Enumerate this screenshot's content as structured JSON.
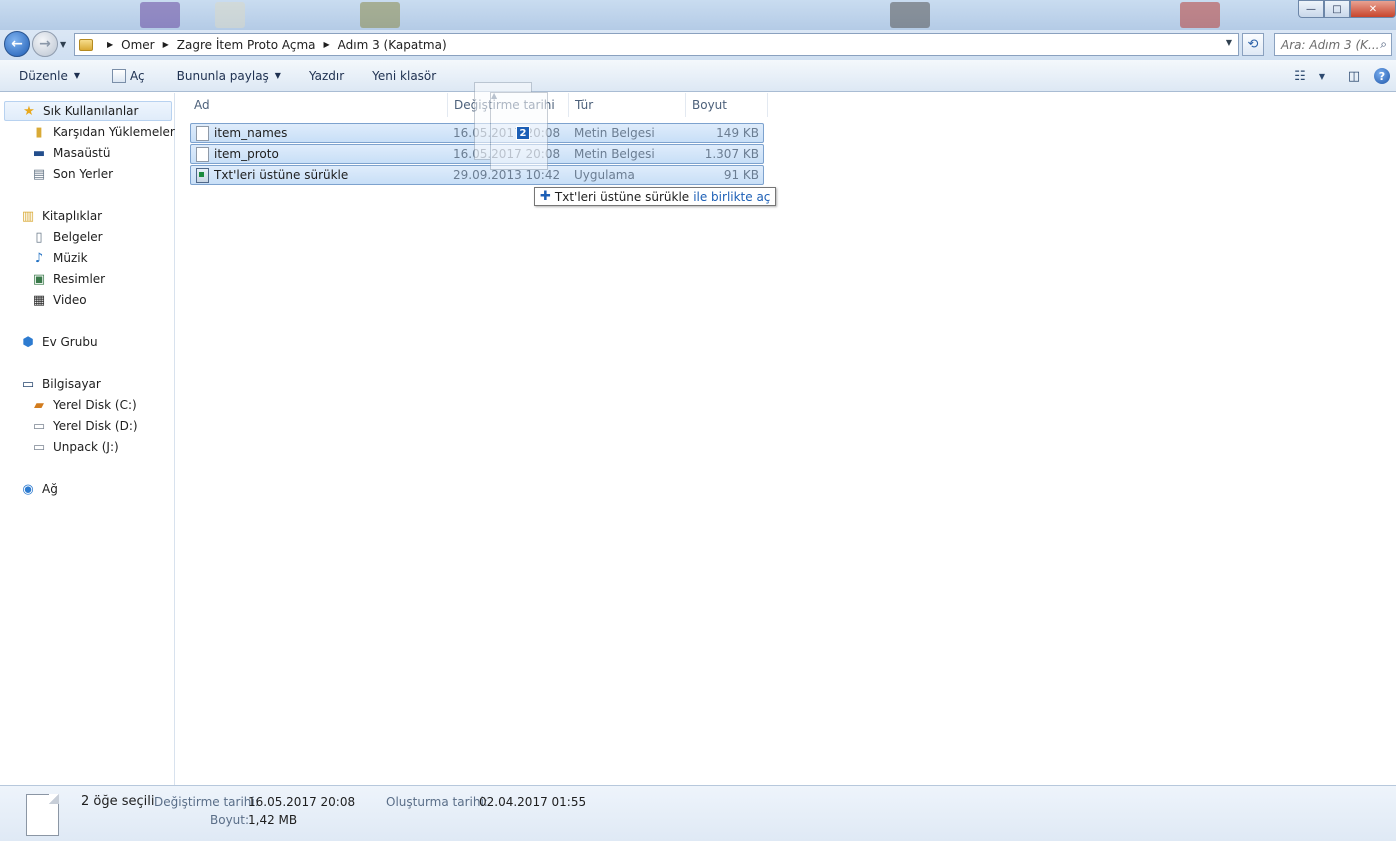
{
  "window": {
    "controls": {
      "minimize": "—",
      "maximize": "□",
      "close": "✕"
    }
  },
  "address": {
    "crumbs": [
      "Omer",
      "Zagre İtem Proto Açma",
      "Adım 3 (Kapatma)"
    ],
    "search_placeholder": "Ara: Adım 3 (K..."
  },
  "toolbar": {
    "organize": "Düzenle",
    "open": "Aç",
    "share": "Bununla paylaş",
    "print": "Yazdır",
    "new_folder": "Yeni klasör"
  },
  "sidebar": {
    "favorites": {
      "label": "Sık Kullanılanlar",
      "items": [
        "Karşıdan Yüklemeler",
        "Masaüstü",
        "Son Yerler"
      ]
    },
    "libraries": {
      "label": "Kitaplıklar",
      "items": [
        "Belgeler",
        "Müzik",
        "Resimler",
        "Video"
      ]
    },
    "homegroup": {
      "label": "Ev Grubu"
    },
    "computer": {
      "label": "Bilgisayar",
      "items": [
        "Yerel Disk (C:)",
        "Yerel Disk (D:)",
        "Unpack (J:)"
      ]
    },
    "network": {
      "label": "Ağ"
    }
  },
  "columns": {
    "name": "Ad",
    "date": "Değiştirme tarihi",
    "type": "Tür",
    "size": "Boyut"
  },
  "files": [
    {
      "name": "item_names",
      "date": "16.05.2017 20:08",
      "type": "Metin Belgesi",
      "size": "149 KB",
      "icon": "text-file-icon"
    },
    {
      "name": "item_proto",
      "date": "16.05.2017 20:08",
      "type": "Metin Belgesi",
      "size": "1.307 KB",
      "icon": "text-file-icon"
    },
    {
      "name": "Txt'leri üstüne sürükle",
      "date": "29.09.2013 10:42",
      "type": "Uygulama",
      "size": "91 KB",
      "icon": "application-icon"
    }
  ],
  "drag": {
    "count": "2",
    "target": "Txt'leri üstüne sürükle",
    "action": "ile birlikte aç"
  },
  "details": {
    "selection": "2 öğe seçili",
    "modified_label": "Değiştirme tarihi:",
    "modified_value": "16.05.2017 20:08",
    "created_label": "Oluşturma tarihi:",
    "created_value": "02.04.2017 01:55",
    "size_label": "Boyut:",
    "size_value": "1,42 MB"
  }
}
